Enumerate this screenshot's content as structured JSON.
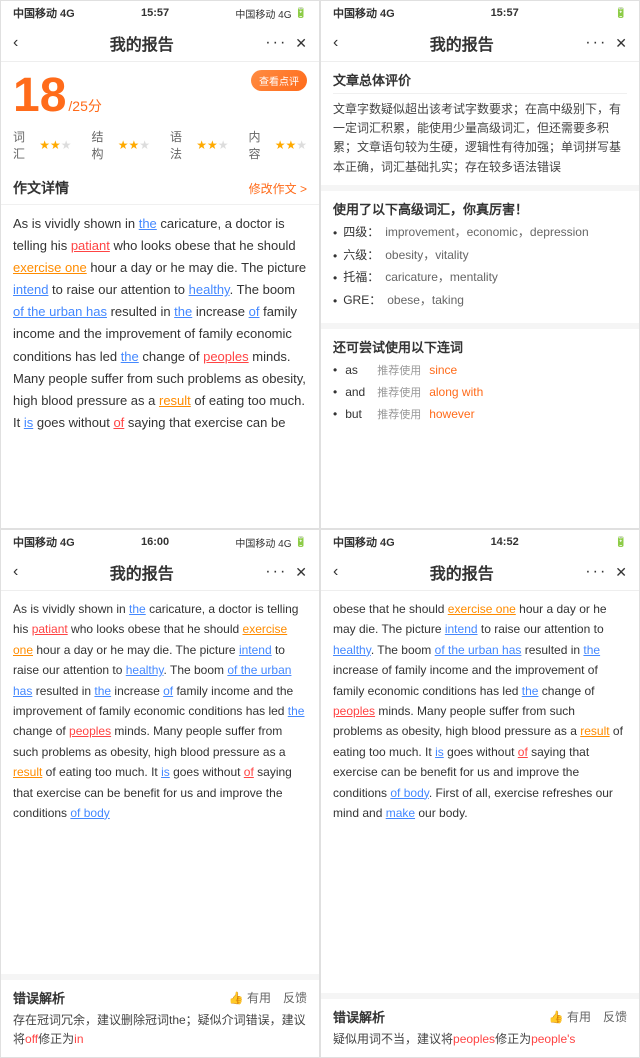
{
  "panels": [
    {
      "id": "top-left",
      "status": {
        "left": "中国移动 4G",
        "center": "15:57",
        "right": "中国移动 4G"
      },
      "nav": {
        "title": "我的报告",
        "dots": "···"
      },
      "score": {
        "review_btn": "查看点评",
        "number": "18",
        "total": "/25分",
        "items": [
          {
            "label": "词汇",
            "stars": 2,
            "max": 3
          },
          {
            "label": "结构",
            "stars": 2,
            "max": 3
          },
          {
            "label": "语法",
            "stars": 2,
            "max": 3
          },
          {
            "label": "内容",
            "stars": 2,
            "max": 3
          }
        ]
      },
      "essay": {
        "section_title": "作文详情",
        "section_link": "修改作文 >",
        "text_parts": [
          "As is vividly shown in ",
          "the",
          " caricature, a doctor is telling his ",
          "patiant",
          " who looks obese that he should ",
          "exercise one",
          " hour a day or he may die. The picture ",
          "intend",
          " to raise our attention to ",
          "healthy",
          ". The boom ",
          "of the urban has",
          " resulted in ",
          "the",
          " increase ",
          "of",
          " family income and the improvement of family economic conditions has led ",
          "the",
          " change of ",
          "peoples",
          " minds. Many people suffer from such problems as obesity, high blood pressure as a ",
          "result",
          " of eating too much. It ",
          "is",
          " goes without ",
          "of",
          " saying that exercise can be"
        ]
      }
    },
    {
      "id": "top-right",
      "status": {
        "left": "中国移动 4G",
        "center": "15:57",
        "right": ""
      },
      "nav": {
        "title": "我的报告",
        "dots": "···"
      },
      "overall_eval": {
        "title": "文章总体评价",
        "text": "文章字数疑似超出该考试字数要求；在高中级别下，有一定词汇积累，能使用少量高级词汇，但还需要多积累；文章语句较为生硬，逻辑性有待加强；单词拼写基本正确，词汇基础扎实；存在较多语法错误"
      },
      "vocab": {
        "title": "使用了以下高级词汇，你真厉害！",
        "items": [
          {
            "level": "四级：",
            "words": "improvement，economic，depression"
          },
          {
            "level": "六级：",
            "words": "obesity，vitality"
          },
          {
            "level": "托福：",
            "words": "caricature，mentality"
          },
          {
            "level": "GRE：",
            "words": "obese，taking"
          }
        ]
      },
      "connector": {
        "title": "还可尝试使用以下连词",
        "items": [
          {
            "word": "as",
            "recommend": "推荐使用",
            "alt": "since"
          },
          {
            "word": "and",
            "recommend": "推荐使用",
            "alt": "along with"
          },
          {
            "word": "but",
            "recommend": "推荐使用",
            "alt": "however"
          }
        ]
      }
    },
    {
      "id": "bottom-left",
      "status": {
        "left": "中国移动 4G",
        "center": "16:00",
        "right": "中国移动 4G"
      },
      "nav": {
        "title": "我的报告",
        "dots": "···"
      },
      "essay": {
        "text_parts": [
          "As is vividly shown in ",
          "the",
          " caricature, a doctor is telling his ",
          "patiant",
          " who looks obese that he should ",
          "exercise one",
          " hour a day or he may die. The picture ",
          "intend",
          " to raise our attention to ",
          "healthy",
          ". The boom ",
          "of the urban has",
          " resulted in ",
          "the",
          " increase ",
          "of",
          " family income and the improvement of family economic conditions has led ",
          "the",
          " change of ",
          "peoples",
          " minds. Many people suffer from such problems as obesity, high blood pressure as a ",
          "result",
          " of eating too much. It ",
          "is",
          " goes without ",
          "of",
          " saying that exercise can be benefit for us and improve the conditions ",
          "of body"
        ]
      },
      "error": {
        "title": "错误解析",
        "actions": [
          "有用",
          "反馈"
        ],
        "text": "存在冠词冗余，建议删除冠词the；疑似介词错误，建议将",
        "highlight": "off",
        "text2": "修正为",
        "highlight2": "in"
      }
    },
    {
      "id": "bottom-right",
      "status": {
        "left": "中国移动 4G",
        "center": "14:52",
        "right": ""
      },
      "nav": {
        "title": "我的报告",
        "dots": "···"
      },
      "essay": {
        "text_parts": [
          "obese that he should ",
          "exercise one",
          " hour a day or he may die. The picture ",
          "intend",
          " to raise our attention to ",
          "healthy",
          ". The boom ",
          "of the urban has",
          " resulted in ",
          "the",
          " increase of family income and the improvement of family economic conditions has led ",
          "the",
          " change of ",
          "peoples",
          " minds. Many people suffer from such problems as obesity, high blood pressure as a ",
          "result",
          " of eating too much. It ",
          "is",
          " goes without ",
          "of",
          " saying that exercise can be benefit for us and improve the conditions ",
          "of body",
          ". First of all, exercise refreshes our mind and ",
          "make",
          " our body."
        ]
      },
      "error": {
        "title": "错误解析",
        "actions": [
          "有用",
          "反馈"
        ],
        "text": "疑似用词不当，建议将",
        "highlight": "peoples",
        "text2": "修正为",
        "highlight2": "people's"
      }
    }
  ]
}
